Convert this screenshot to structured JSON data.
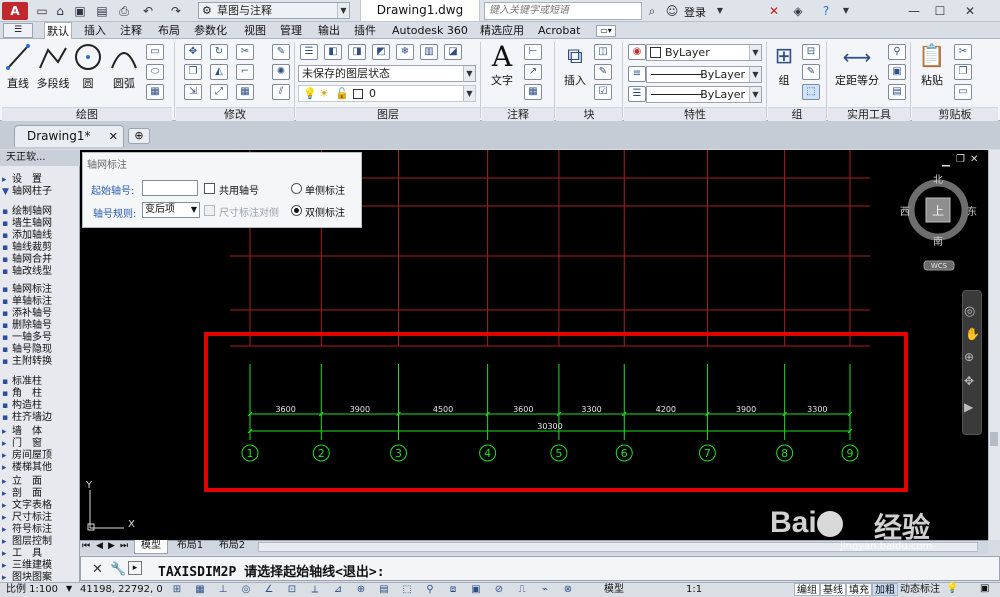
{
  "titlebar": {
    "workspace": "草图与注释",
    "doc_title": "Drawing1.dwg",
    "search_placeholder": "键入关键字或短语",
    "login": "登录"
  },
  "ribbon_tabs": [
    "默认",
    "插入",
    "注释",
    "布局",
    "参数化",
    "视图",
    "管理",
    "输出",
    "插件",
    "Autodesk 360",
    "精选应用",
    "Acrobat"
  ],
  "ribbon": {
    "draw_tools": [
      "直线",
      "多段线",
      "圆",
      "圆弧"
    ],
    "panels": [
      "绘图",
      "修改",
      "图层",
      "注释",
      "块",
      "特性",
      "组",
      "实用工具",
      "剪贴板"
    ],
    "layer_state": "未保存的图层状态",
    "layer_current": "0",
    "text_label": "文字",
    "insert_label": "插入",
    "color": "ByLayer",
    "linetype": "ByLayer",
    "lineweight": "ByLayer",
    "group_label": "组",
    "measure_label": "定距等分",
    "paste_label": "粘贴"
  },
  "doc_tab": "Drawing1*",
  "tianzheng": {
    "header": "天正软...",
    "items": [
      "轴网柱子",
      "设　置",
      "绘制轴网",
      "墙生轴网",
      "添加轴线",
      "轴线裁剪",
      "轴网合并",
      "轴改线型",
      "轴网标注",
      "单轴标注",
      "添补轴号",
      "删除轴号",
      "一轴多号",
      "轴号隐现",
      "主附转换",
      "标准柱",
      "角　柱",
      "构造柱",
      "柱齐墙边",
      "墙　体",
      "门　窗",
      "房间屋顶",
      "楼梯其他",
      "立　面",
      "剖　面",
      "文字表格",
      "尺寸标注",
      "符号标注",
      "图层控制",
      "工　具",
      "三维建模",
      "图块图案"
    ]
  },
  "dialog": {
    "title": "轴网标注",
    "start_label": "起始轴号:",
    "start_value": "",
    "share_label": "共用轴号",
    "rule_label": "轴号规则:",
    "rule_value": "变后项",
    "dim_label": "尺寸标注对侧",
    "single_label": "单侧标注",
    "double_label": "双侧标注"
  },
  "drawing": {
    "spacings": [
      "3600",
      "3900",
      "4500",
      "3600",
      "3300",
      "4200",
      "3900",
      "3300"
    ],
    "total": "30300",
    "axis_numbers": [
      "1",
      "2",
      "3",
      "4",
      "5",
      "6",
      "7",
      "8",
      "9"
    ]
  },
  "viewcube": {
    "north": "北",
    "south": "南",
    "east": "东",
    "west": "西",
    "top": "上",
    "wcs": "WCS"
  },
  "ucs": {
    "x": "X",
    "y": "Y"
  },
  "layout_tabs": [
    "模型",
    "布局1",
    "布局2"
  ],
  "command": {
    "text": "TAXISDIM2P 请选择起始轴线<退出>:"
  },
  "status": {
    "scale": "比例 1:100",
    "coords": "41198, 22792, 0",
    "model": "模型",
    "anno_scale": "1:1",
    "toggles": [
      "编组",
      "基线",
      "填充",
      "加粗",
      "动态标注"
    ]
  },
  "watermark": {
    "site": "jingyan.baidu.com",
    "brand_text": "经验"
  },
  "colors": {
    "accent": "#2a6fd6",
    "red_box": "#e00000",
    "axis_green": "#22dd22",
    "grid_red": "#a52020"
  }
}
